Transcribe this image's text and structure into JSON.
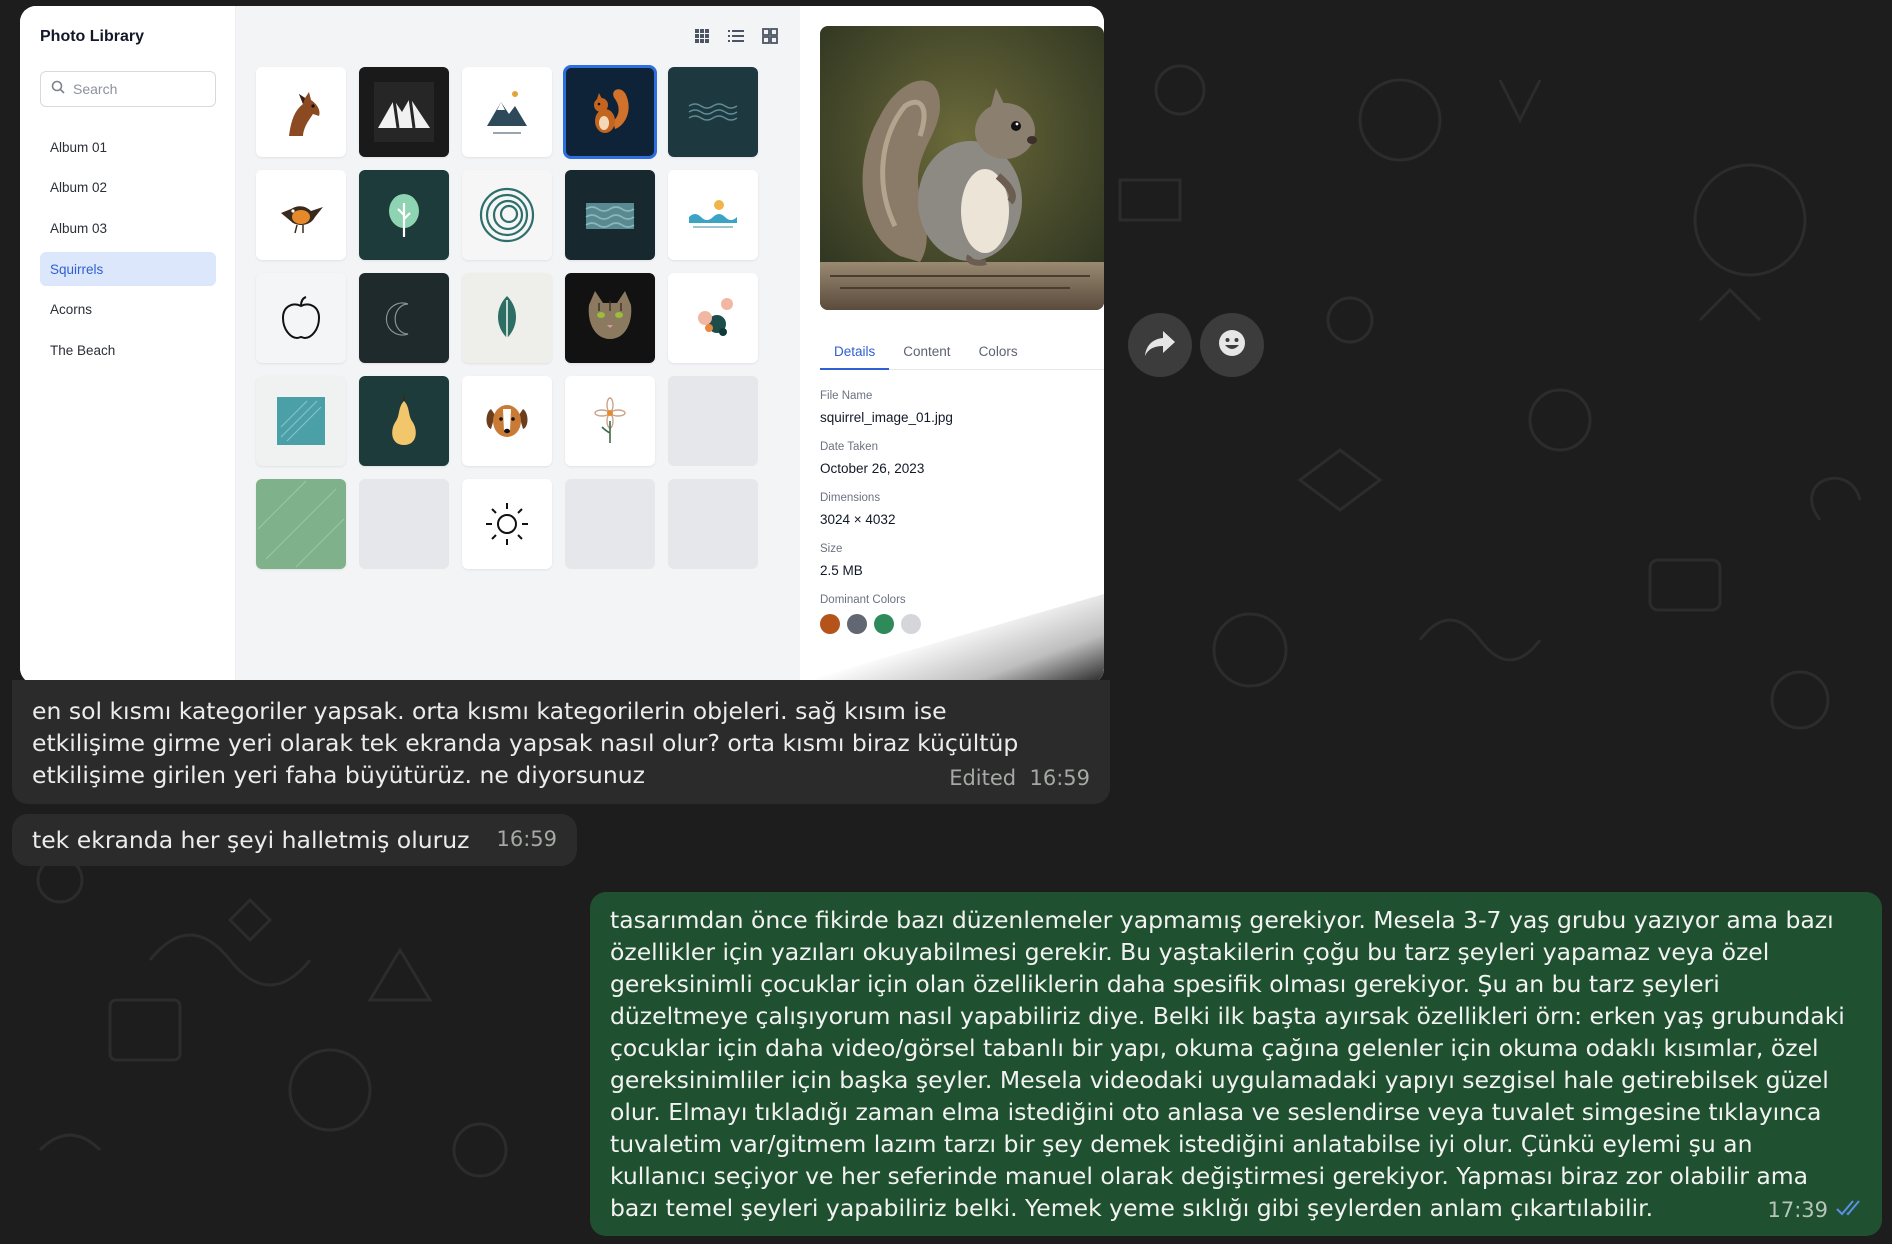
{
  "colors": {
    "chat_background": "#1c1d1c",
    "incoming_bubble": "#2a2b2a",
    "outgoing_bubble": "#1f5130",
    "accent_blue": "#2f5fd0",
    "read_receipt": "#5b8fe8"
  },
  "screenshot": {
    "app_title": "Photo Library",
    "search": {
      "placeholder": "Search",
      "icon": "search-icon"
    },
    "albums": [
      {
        "label": "Album 01",
        "active": false
      },
      {
        "label": "Album 02",
        "active": false
      },
      {
        "label": "Album 03",
        "active": false
      },
      {
        "label": "Squirrels",
        "active": true
      },
      {
        "label": "Acorns",
        "active": false
      },
      {
        "label": "The Beach",
        "active": false
      }
    ],
    "view_icons": [
      "grid-small-icon",
      "list-icon",
      "grid-large-icon"
    ],
    "tiles": [
      "horse-icon",
      "mountain-dark-icon",
      "mountain-light-icon",
      "squirrel-icon",
      "waves-dark-icon",
      "bird-icon",
      "tree-icon",
      "spiral-icon",
      "water-pattern-icon",
      "ocean-illustration-icon",
      "apple-icon",
      "moon-crescent-icon",
      "leaf-icon",
      "cat-icon",
      "abstract-shapes-icon",
      "teal-texture-icon",
      "pear-icon",
      "dog-icon",
      "flower-icon",
      "empty-placeholder",
      "green-texture-icon",
      "empty-placeholder",
      "sun-icon",
      "empty-placeholder",
      "empty-placeholder"
    ],
    "selected_tile": "squirrel-icon",
    "preview": {
      "image": "squirrel-photo"
    },
    "tabs": [
      {
        "label": "Details",
        "active": true
      },
      {
        "label": "Content",
        "active": false
      },
      {
        "label": "Colors",
        "active": false
      }
    ],
    "fields": {
      "file_name_label": "File Name",
      "file_name": "squirrel_image_01.jpg",
      "date_label": "Date Taken",
      "date": "October 26, 2023",
      "dimensions_label": "Dimensions",
      "dimensions": "3024 × 4032",
      "size_label": "Size",
      "size": "2.5 MB",
      "colors_label": "Dominant Colors"
    },
    "dominant_colors": [
      "#b4541a",
      "#636673",
      "#2f8a5a",
      "#d4d6da"
    ]
  },
  "messages": [
    {
      "direction": "incoming",
      "text": "en sol kısmı kategoriler yapsak. orta kısmı kategorilerin objeleri.  sağ kısım  ise\netkilişime girme yeri olarak tek ekranda yapsak nasıl olur? orta kısmı biraz küçültüp\netkilişime girilen yeri faha büyütürüz. ne diyorsunuz",
      "edited": "Edited",
      "time": "16:59"
    },
    {
      "direction": "incoming",
      "text": "tek ekranda her şeyi halletmiş oluruz",
      "time": "16:59"
    },
    {
      "direction": "outgoing",
      "text": "tasarımdan önce fikirde bazı düzenlemeler yapmamış gerekiyor. Mesela 3-7 yaş grubu yazıyor ama bazı\nözellikler için yazıları okuyabilmesi gerekir. Bu yaştakilerin çoğu bu tarz şeyleri yapamaz veya özel\ngereksinimli çocuklar için olan özelliklerin daha spesifik olması gerekiyor. Şu an bu tarz şeyleri\ndüzeltmeye çalışıyorum nasıl yapabiliriz diye. Belki ilk başta ayırsak özellikleri örn: erken yaş grubundaki\nçocuklar için daha video/görsel tabanlı bir yapı, okuma çağına gelenler için okuma odaklı kısımlar, özel\ngereksinimliler için başka şeyler. Mesela videodaki uygulamadaki yapıyı sezgisel hale getirebilsek güzel\nolur. Elmayı tıkladığı zaman elma istediğini oto anlasa ve seslendirse veya tuvalet simgesine tıklayınca\ntuvaletim var/gitmem lazım tarzı bir şey demek istediğini anlatabilse iyi olur. Çünkü eylemi şu an\nkullanıcı seçiyor ve her seferinde manuel olarak değiştirmesi gerekiyor. Yapması biraz zor olabilir ama\nbazı temel şeyleri yapabiliriz belki. Yemek yeme sıklığı gibi şeylerden anlam çıkartılabilir.",
      "time": "17:39",
      "status": "read"
    }
  ],
  "actions": {
    "forward_icon": "forward-icon",
    "emoji_icon": "emoji-icon"
  }
}
